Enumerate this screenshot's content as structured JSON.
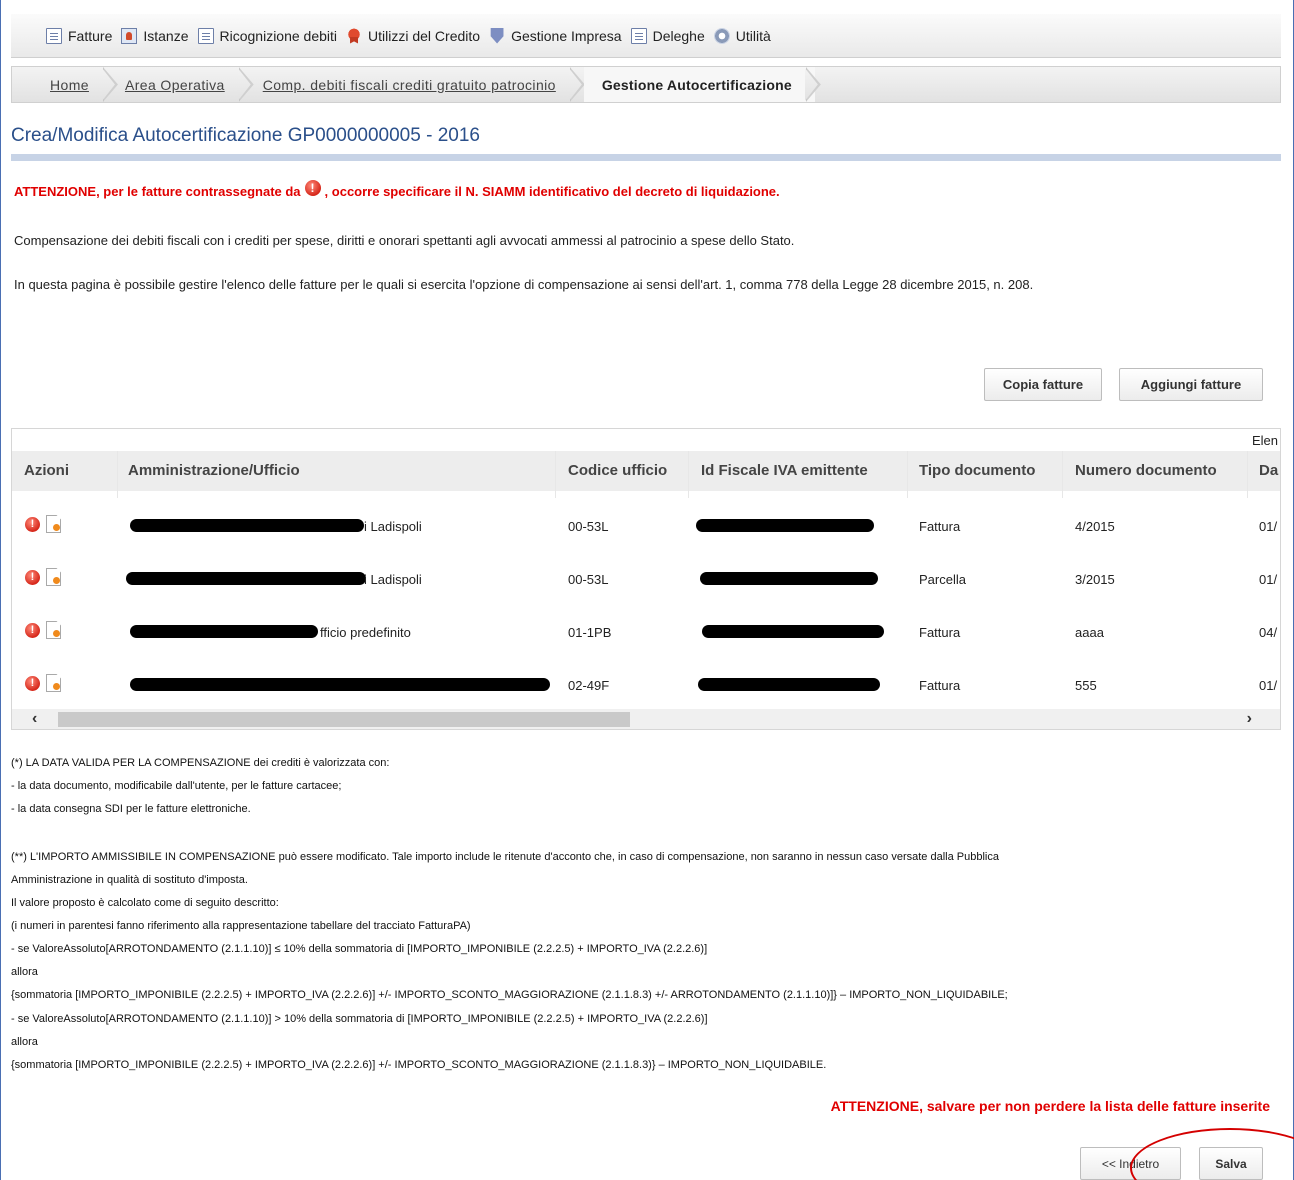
{
  "menu": {
    "items": [
      {
        "label": "Fatture",
        "icon": "document-icon"
      },
      {
        "label": "Istanze",
        "icon": "person-icon"
      },
      {
        "label": "Ricognizione debiti",
        "icon": "document-icon"
      },
      {
        "label": "Utilizzi del Credito",
        "icon": "ribbon-icon"
      },
      {
        "label": "Gestione Impresa",
        "icon": "shield-icon"
      },
      {
        "label": "Deleghe",
        "icon": "document-icon"
      },
      {
        "label": "Utilità",
        "icon": "gear-icon"
      }
    ]
  },
  "breadcrumb": {
    "items": [
      "Home",
      "Area Operativa",
      "Comp. debiti fiscali crediti gratuito patrocinio"
    ],
    "current": "Gestione Autocertificazione"
  },
  "page": {
    "title": "Crea/Modifica Autocertificazione GP0000000005 - 2016",
    "warning_before": "ATTENZIONE, per le fatture contrassegnate da",
    "warning_after": ", occorre specificare il N. SIAMM identificativo del decreto di liquidazione.",
    "description": "Compensazione dei debiti fiscali con i crediti per spese, diritti e onorari spettanti agli avvocati ammessi al patrocinio a spese dello Stato.",
    "info": "In questa pagina è possibile gestire l'elenco delle fatture per le quali si esercita l'opzione di compensazione ai sensi dell'art. 1, comma 778 della Legge 28 dicembre 2015, n. 208."
  },
  "buttons": {
    "copia": "Copia fatture",
    "aggiungi": "Aggiungi fatture",
    "indietro": "<< Indietro",
    "salva": "Salva"
  },
  "table": {
    "caption_partial": "Elen",
    "columns": [
      "Azioni",
      "Amministrazione/Ufficio",
      "Codice ufficio",
      "Id Fiscale IVA emittente",
      "Tipo documento",
      "Numero documento",
      "Da"
    ],
    "rows": [
      {
        "amministrazione": "i Ladispoli",
        "codice": "00-53L",
        "tipo": "Fattura",
        "numero": "4/2015",
        "data": "01/"
      },
      {
        "amministrazione": "i Ladispoli",
        "codice": "00-53L",
        "tipo": "Parcella",
        "numero": "3/2015",
        "data": "01/"
      },
      {
        "amministrazione": "fficio predefinito",
        "codice": "01-1PB",
        "tipo": "Fattura",
        "numero": "aaaa",
        "data": "04/"
      },
      {
        "amministrazione": "",
        "codice": "02-49F",
        "tipo": "Fattura",
        "numero": "555",
        "data": "01/"
      }
    ]
  },
  "notes": [
    "(*) LA DATA VALIDA PER LA COMPENSAZIONE dei crediti è valorizzata con:",
    "- la data documento, modificabile dall'utente, per le fatture cartacee;",
    "- la data consegna SDI per le fatture elettroniche.",
    "(**) L'IMPORTO AMMISSIBILE IN COMPENSAZIONE può essere modificato. Tale importo include le ritenute d'acconto che, in caso di compensazione, non saranno in nessun caso versate dalla Pubblica",
    "Amministrazione in qualità di sostituto d'imposta.",
    "Il valore proposto è calcolato come di seguito descritto:",
    "(i numeri in parentesi fanno riferimento alla rappresentazione tabellare del tracciato FatturaPA)",
    "- se ValoreAssoluto[ARROTONDAMENTO (2.1.1.10)] ≤ 10% della sommatoria di [IMPORTO_IMPONIBILE (2.2.2.5) + IMPORTO_IVA (2.2.2.6)]",
    "allora",
    "{sommatoria [IMPORTO_IMPONIBILE (2.2.2.5) + IMPORTO_IVA (2.2.2.6)] +/- IMPORTO_SCONTO_MAGGIORAZIONE (2.1.1.8.3) +/- ARROTONDAMENTO (2.1.1.10)]} – IMPORTO_NON_LIQUIDABILE;",
    "- se ValoreAssoluto[ARROTONDAMENTO (2.1.1.10)] > 10% della sommatoria di [IMPORTO_IMPONIBILE (2.2.2.5) + IMPORTO_IVA (2.2.2.6)]",
    "allora",
    "{sommatoria [IMPORTO_IMPONIBILE (2.2.2.5) + IMPORTO_IVA (2.2.2.6)] +/- IMPORTO_SCONTO_MAGGIORAZIONE (2.1.1.8.3)} – IMPORTO_NON_LIQUIDABILE."
  ],
  "bottom_warning": "ATTENZIONE, salvare per non perdere la lista delle fatture inserite",
  "colors": {
    "warning": "#e00000",
    "title": "#2a4f8a",
    "annotation": "#d40000"
  }
}
